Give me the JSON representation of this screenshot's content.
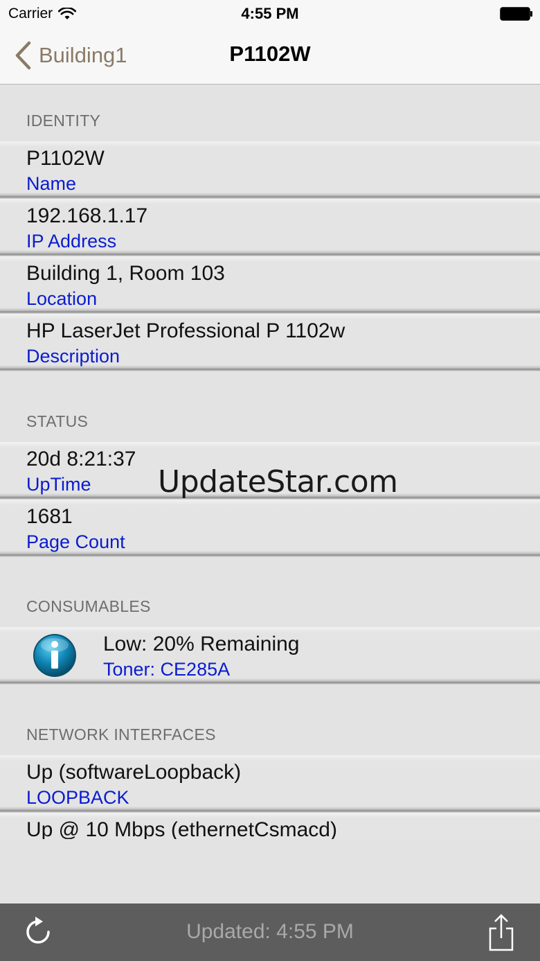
{
  "status_bar": {
    "carrier": "Carrier",
    "time": "4:55 PM"
  },
  "nav": {
    "back_label": "Building1",
    "title": "P1102W"
  },
  "sections": {
    "identity": {
      "header": "IDENTITY",
      "rows": [
        {
          "value": "P1102W",
          "label": "Name"
        },
        {
          "value": "192.168.1.17",
          "label": "IP Address"
        },
        {
          "value": "Building 1, Room 103",
          "label": "Location"
        },
        {
          "value": "HP LaserJet Professional P 1102w",
          "label": "Description"
        }
      ]
    },
    "status": {
      "header": "STATUS",
      "rows": [
        {
          "value": "20d 8:21:37",
          "label": "UpTime"
        },
        {
          "value": "1681",
          "label": "Page Count"
        }
      ]
    },
    "consumables": {
      "header": "CONSUMABLES",
      "rows": [
        {
          "value": "Low: 20% Remaining",
          "label": "Toner: CE285A",
          "icon": "info-icon"
        }
      ]
    },
    "network": {
      "header": "NETWORK INTERFACES",
      "rows": [
        {
          "value": "Up (softwareLoopback)",
          "label": "LOOPBACK"
        },
        {
          "value": "Up @ 10 Mbps (ethernetCsmacd)",
          "label": ""
        }
      ]
    }
  },
  "watermark": "UpdateStar.com",
  "toolbar": {
    "updated_text": "Updated: 4:55 PM",
    "refresh_icon": "refresh-icon",
    "share_icon": "share-icon"
  },
  "colors": {
    "label_blue": "#0a1ccf",
    "back_tint": "#8a7b66",
    "toolbar_bg": "#5d5d5d"
  }
}
